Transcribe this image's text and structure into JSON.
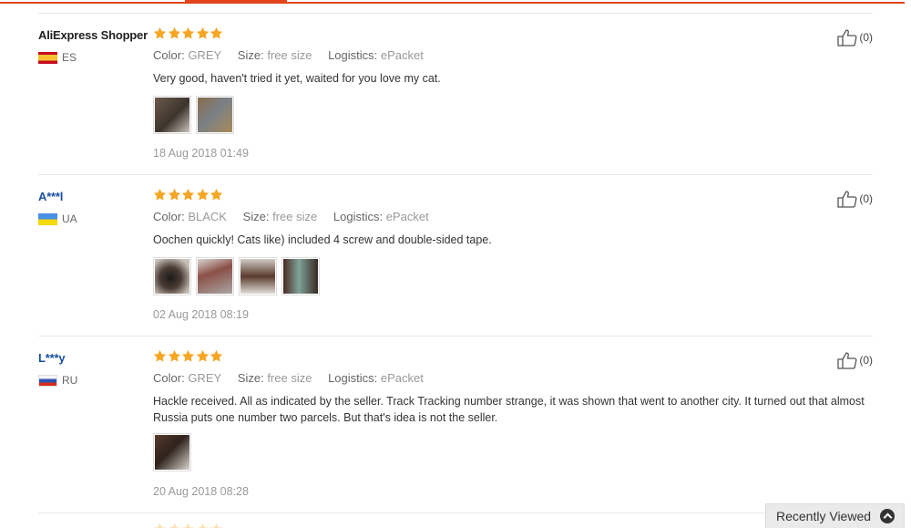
{
  "colors": {
    "accent": "#e0451b",
    "star": "#f5a623",
    "muted": "#999999",
    "link": "#1a4e9e"
  },
  "reviews": [
    {
      "user": "AliExpress Shopper",
      "country": "ES",
      "rating": 5,
      "attrs": [
        {
          "key": "Color:",
          "value": "GREY"
        },
        {
          "key": "Size:",
          "value": "free size"
        },
        {
          "key": "Logistics:",
          "value": "ePacket"
        }
      ],
      "text": "Very good, haven't tried it yet, waited for you love my cat.",
      "photo_count": 2,
      "date": "18 Aug 2018 01:49",
      "useful": "(0)"
    },
    {
      "user": "A***l",
      "country": "UA",
      "rating": 5,
      "attrs": [
        {
          "key": "Color:",
          "value": "BLACK"
        },
        {
          "key": "Size:",
          "value": "free size"
        },
        {
          "key": "Logistics:",
          "value": "ePacket"
        }
      ],
      "text": "Oochen quickly! Cats like) included 4 screw and double-sided tape.",
      "photo_count": 4,
      "date": "02 Aug 2018 08:19",
      "useful": "(0)"
    },
    {
      "user": "L***y",
      "country": "RU",
      "rating": 5,
      "attrs": [
        {
          "key": "Color:",
          "value": "GREY"
        },
        {
          "key": "Size:",
          "value": "free size"
        },
        {
          "key": "Logistics:",
          "value": "ePacket"
        }
      ],
      "text": "Hackle received. All as indicated by the seller. Track Tracking number strange, it was shown that went to another city. It turned out that almost Russia puts one number two parcels. But that's idea is not the seller.",
      "photo_count": 1,
      "date": "20 Aug 2018 08:28",
      "useful": "(0)"
    }
  ],
  "recently_viewed": {
    "label": "Recently Viewed",
    "icon": "chevron-up-circle-icon"
  }
}
